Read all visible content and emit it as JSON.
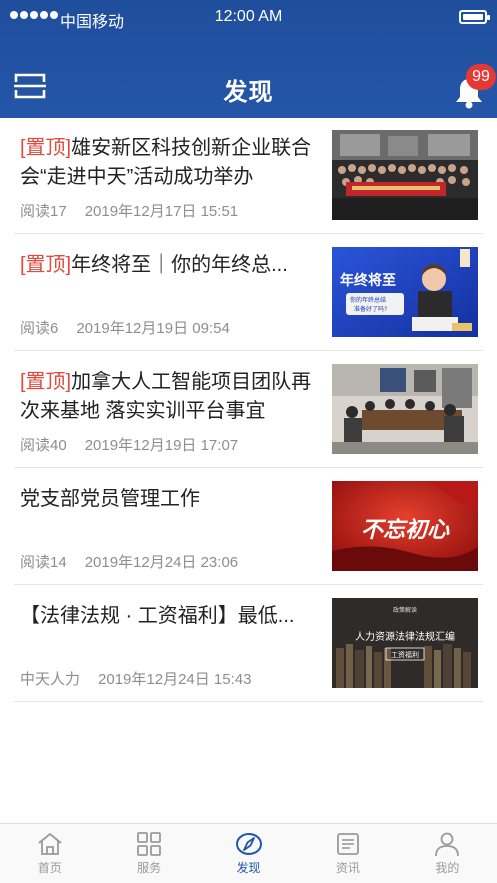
{
  "status_bar": {
    "carrier": "中国移动",
    "time": "12:00 AM"
  },
  "nav": {
    "title": "发现",
    "scan_icon": "scan-icon",
    "bell_icon": "bell-icon",
    "notification_count": "99"
  },
  "news": [
    {
      "pinned": true,
      "pin_label": "[置顶]",
      "title": "雄安新区科技创新企业联合会“走进中天”活动成功举办",
      "reads": "阅读17",
      "date": "2019年12月17日 15:51",
      "thumb": "group-photo"
    },
    {
      "pinned": true,
      "pin_label": "[置顶]",
      "title": "年终将至｜你的年终总...",
      "reads": "阅读6",
      "date": "2019年12月19日 09:54",
      "thumb": "year-end",
      "thumb_text": "年终将至",
      "thumb_subtext": "你的年终总结\n准备好了吗?"
    },
    {
      "pinned": true,
      "pin_label": "[置顶]",
      "title": "加拿大人工智能项目团队再次来基地 落实实训平台事宜",
      "reads": "阅读40",
      "date": "2019年12月19日 17:07",
      "thumb": "meeting-room"
    },
    {
      "pinned": false,
      "pin_label": "",
      "title": "党支部党员管理工作",
      "reads": "阅读14",
      "date": "2019年12月24日 23:06",
      "thumb": "party-red",
      "thumb_text": "不忘初心"
    },
    {
      "pinned": false,
      "pin_label": "",
      "title": "【法律法规 · 工资福利】最低...",
      "reads": "中天人力",
      "date": "2019年12月24日 15:43",
      "thumb": "law-books",
      "thumb_text": "人力资源法律法规汇编",
      "thumb_subtext": "工资福利",
      "thumb_top": "政策解读"
    }
  ],
  "tabs": [
    {
      "label": "首页",
      "icon": "home-icon",
      "active": false
    },
    {
      "label": "服务",
      "icon": "grid-icon",
      "active": false
    },
    {
      "label": "发现",
      "icon": "compass-icon",
      "active": true
    },
    {
      "label": "资讯",
      "icon": "news-icon",
      "active": false
    },
    {
      "label": "我的",
      "icon": "user-icon",
      "active": false
    }
  ],
  "colors": {
    "primary": "#2456a8",
    "pin_red": "#e04a3f",
    "badge_red": "#e53935",
    "meta_gray": "#8e8e8e"
  }
}
